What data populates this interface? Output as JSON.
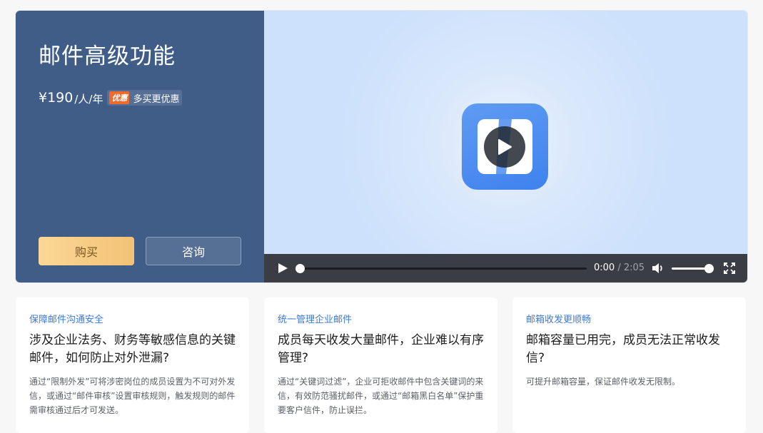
{
  "panel": {
    "title": "邮件高级功能",
    "price": "¥190",
    "price_unit": "/人/年",
    "promo_tag": "优惠",
    "promo_text": "多买更优惠",
    "buy_label": "购买",
    "consult_label": "咨询"
  },
  "video": {
    "current_time": "0:00",
    "separator": "/",
    "duration": "2:05",
    "progress": 0,
    "volume": 1
  },
  "cards": [
    {
      "tag": "保障邮件沟通安全",
      "title": "涉及企业法务、财务等敏感信息的关键邮件，如何防止对外泄漏?",
      "desc": "通过“限制外发”可将涉密岗位的成员设置为不可对外发信，或通过“邮件审核”设置审核规则，触发规则的邮件需审核通过后才可发送。"
    },
    {
      "tag": "统一管理企业邮件",
      "title": "成员每天收发大量邮件，企业难以有序管理?",
      "desc": "通过“关键词过滤”，企业可拒收邮件中包含关键词的来信，有效防范骚扰邮件，或通过“邮箱黑白名单”保护重要客户信件，防止误拦。"
    },
    {
      "tag": "邮箱收发更顺畅",
      "title": "邮箱容量已用完，成员无法正常收发信?",
      "desc": "可提升邮箱容量，保证邮件收发无限制。"
    }
  ]
}
